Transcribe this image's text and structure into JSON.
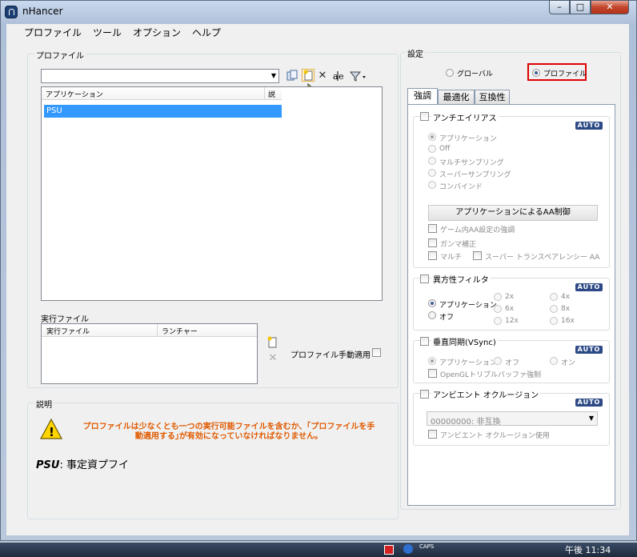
{
  "window": {
    "title": "nHancer",
    "min": "–",
    "max": "□",
    "close": "✕"
  },
  "menu": [
    "プロファイル",
    "ツール",
    "オプション",
    "ヘルプ"
  ],
  "profile": {
    "group_title": "プロファイル",
    "combo_value": "",
    "combo_arrow": "▼",
    "columns": [
      "アプリケーション",
      "説"
    ],
    "rows": [
      "PSU"
    ]
  },
  "exec": {
    "group_title": "実行ファイル",
    "columns": [
      "実行ファイル",
      "ランチャー"
    ],
    "manual_label": "プロファイル手動適用"
  },
  "desc": {
    "group_title": "説明",
    "warning": "プロファイルは少なくとも一つの実行可能ファイルを含むか、｢プロファイルを手動適用する｣が有効になっていなければなりません。",
    "psu_name": "PSU",
    "psu_text": ": 事定資プフイ"
  },
  "settings": {
    "group_title": "設定",
    "radio_global": "グローバル",
    "radio_profile": "プロファイル",
    "tabs": [
      "強調",
      "最適化",
      "互換性"
    ],
    "auto_badge": "AUTO",
    "aa": {
      "title": "アンチエイリアス",
      "options": [
        "アプリケーション",
        "Off",
        "マルチサンプリング",
        "スーパーサンプリング",
        "コンバインド"
      ],
      "button": "アプリケーションによるAA制御",
      "check1": "ゲーム内AA設定の強調",
      "check2": "ガンマ補正",
      "check3": "マルチ",
      "check4": "スーパー  トランスペアレンシー AA"
    },
    "af": {
      "title": "異方性フィルタ",
      "options": [
        "アプリケーション",
        "オフ",
        "2x",
        "6x",
        "12x",
        "4x",
        "8x",
        "16x"
      ]
    },
    "vsync": {
      "title": "垂直同期(VSync)",
      "options": [
        "アプリケーション",
        "オフ",
        "オン"
      ],
      "check": "OpenGLトリプルバッファ強制"
    },
    "ao": {
      "title": "アンビエント オクルージョン",
      "select": "00000000: 非互換",
      "check": "アンビエント オクルージョン使用"
    }
  },
  "taskbar": {
    "caps": "CAPS",
    "time": "午後 11:34"
  },
  "colors": {
    "selection": "#3399ff",
    "warning_text": "#e05a00",
    "highlight_box": "#e00000"
  }
}
